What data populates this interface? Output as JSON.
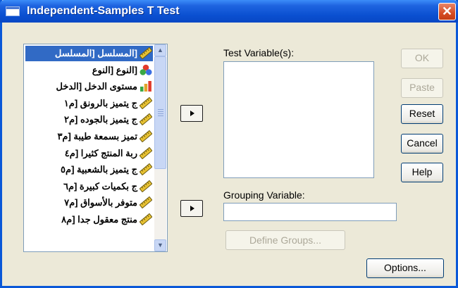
{
  "window": {
    "title": "Independent-Samples T Test"
  },
  "variables": [
    {
      "label": "[المسلسل [المسلسل",
      "icon": "scale-ruler-icon",
      "selected": true
    },
    {
      "label": "[النوع [النوع",
      "icon": "nominal-circles-icon",
      "selected": false
    },
    {
      "label": "مستوى الدخل [الدخل",
      "icon": "ordinal-bars-icon",
      "selected": false
    },
    {
      "label": "ج يتميز بالرونق [م١",
      "icon": "scale-ruler-icon",
      "selected": false
    },
    {
      "label": "ج يتميز بالجوده [م٢",
      "icon": "scale-ruler-icon",
      "selected": false
    },
    {
      "label": "تميز بسمعة طيبة [م٣",
      "icon": "scale-ruler-icon",
      "selected": false
    },
    {
      "label": "ربة المنتج كثيرا [م٤",
      "icon": "scale-ruler-icon",
      "selected": false
    },
    {
      "label": "ج يتميز بالشعبية [م٥",
      "icon": "scale-ruler-icon",
      "selected": false
    },
    {
      "label": "ج بكميات كبيرة [م٦",
      "icon": "scale-ruler-icon",
      "selected": false
    },
    {
      "label": "متوفر بالأسواق [م٧",
      "icon": "scale-ruler-icon",
      "selected": false
    },
    {
      "label": "منتج معقول جدا [م٨",
      "icon": "scale-ruler-icon",
      "selected": false
    }
  ],
  "test_variables": {
    "label": "Test Variable(s):",
    "items": []
  },
  "grouping": {
    "label": "Grouping Variable:",
    "value": ""
  },
  "buttons": {
    "ok": "OK",
    "paste": "Paste",
    "reset": "Reset",
    "cancel": "Cancel",
    "help": "Help",
    "define_groups": "Define Groups...",
    "options": "Options..."
  },
  "colors": {
    "title_bar": "#0a4fd0",
    "selection": "#316ac5",
    "dialog_bg": "#ece9d8",
    "close_button": "#d64b22"
  }
}
